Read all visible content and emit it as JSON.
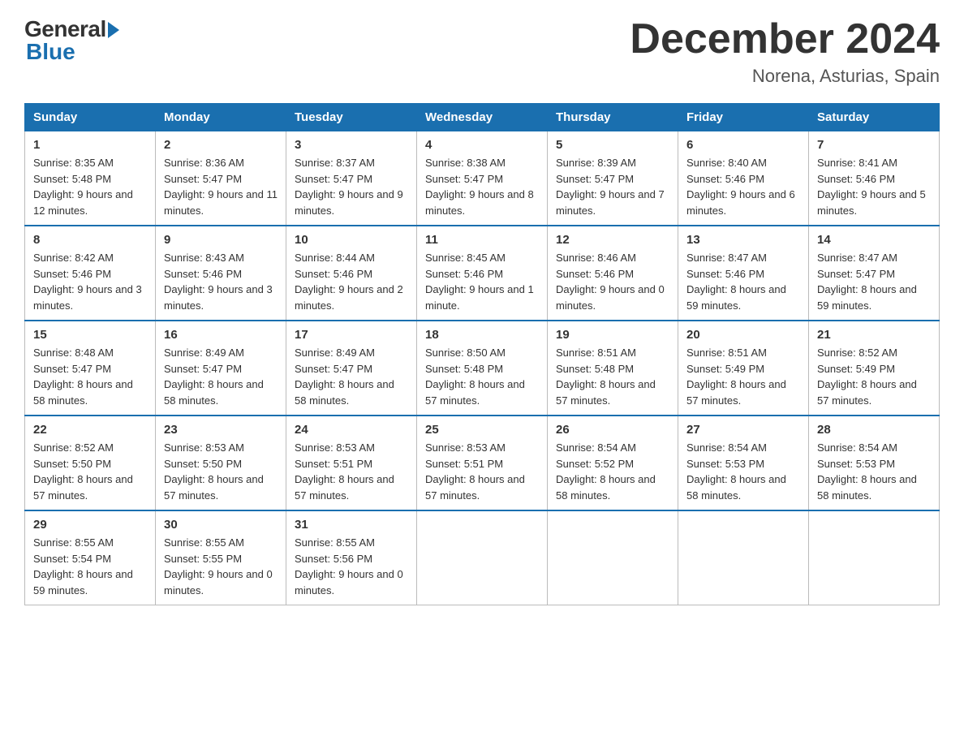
{
  "logo": {
    "general": "General",
    "blue": "Blue"
  },
  "title": "December 2024",
  "subtitle": "Norena, Asturias, Spain",
  "days_of_week": [
    "Sunday",
    "Monday",
    "Tuesday",
    "Wednesday",
    "Thursday",
    "Friday",
    "Saturday"
  ],
  "weeks": [
    [
      {
        "day": "1",
        "sunrise": "8:35 AM",
        "sunset": "5:48 PM",
        "daylight": "9 hours and 12 minutes."
      },
      {
        "day": "2",
        "sunrise": "8:36 AM",
        "sunset": "5:47 PM",
        "daylight": "9 hours and 11 minutes."
      },
      {
        "day": "3",
        "sunrise": "8:37 AM",
        "sunset": "5:47 PM",
        "daylight": "9 hours and 9 minutes."
      },
      {
        "day": "4",
        "sunrise": "8:38 AM",
        "sunset": "5:47 PM",
        "daylight": "9 hours and 8 minutes."
      },
      {
        "day": "5",
        "sunrise": "8:39 AM",
        "sunset": "5:47 PM",
        "daylight": "9 hours and 7 minutes."
      },
      {
        "day": "6",
        "sunrise": "8:40 AM",
        "sunset": "5:46 PM",
        "daylight": "9 hours and 6 minutes."
      },
      {
        "day": "7",
        "sunrise": "8:41 AM",
        "sunset": "5:46 PM",
        "daylight": "9 hours and 5 minutes."
      }
    ],
    [
      {
        "day": "8",
        "sunrise": "8:42 AM",
        "sunset": "5:46 PM",
        "daylight": "9 hours and 3 minutes."
      },
      {
        "day": "9",
        "sunrise": "8:43 AM",
        "sunset": "5:46 PM",
        "daylight": "9 hours and 3 minutes."
      },
      {
        "day": "10",
        "sunrise": "8:44 AM",
        "sunset": "5:46 PM",
        "daylight": "9 hours and 2 minutes."
      },
      {
        "day": "11",
        "sunrise": "8:45 AM",
        "sunset": "5:46 PM",
        "daylight": "9 hours and 1 minute."
      },
      {
        "day": "12",
        "sunrise": "8:46 AM",
        "sunset": "5:46 PM",
        "daylight": "9 hours and 0 minutes."
      },
      {
        "day": "13",
        "sunrise": "8:47 AM",
        "sunset": "5:46 PM",
        "daylight": "8 hours and 59 minutes."
      },
      {
        "day": "14",
        "sunrise": "8:47 AM",
        "sunset": "5:47 PM",
        "daylight": "8 hours and 59 minutes."
      }
    ],
    [
      {
        "day": "15",
        "sunrise": "8:48 AM",
        "sunset": "5:47 PM",
        "daylight": "8 hours and 58 minutes."
      },
      {
        "day": "16",
        "sunrise": "8:49 AM",
        "sunset": "5:47 PM",
        "daylight": "8 hours and 58 minutes."
      },
      {
        "day": "17",
        "sunrise": "8:49 AM",
        "sunset": "5:47 PM",
        "daylight": "8 hours and 58 minutes."
      },
      {
        "day": "18",
        "sunrise": "8:50 AM",
        "sunset": "5:48 PM",
        "daylight": "8 hours and 57 minutes."
      },
      {
        "day": "19",
        "sunrise": "8:51 AM",
        "sunset": "5:48 PM",
        "daylight": "8 hours and 57 minutes."
      },
      {
        "day": "20",
        "sunrise": "8:51 AM",
        "sunset": "5:49 PM",
        "daylight": "8 hours and 57 minutes."
      },
      {
        "day": "21",
        "sunrise": "8:52 AM",
        "sunset": "5:49 PM",
        "daylight": "8 hours and 57 minutes."
      }
    ],
    [
      {
        "day": "22",
        "sunrise": "8:52 AM",
        "sunset": "5:50 PM",
        "daylight": "8 hours and 57 minutes."
      },
      {
        "day": "23",
        "sunrise": "8:53 AM",
        "sunset": "5:50 PM",
        "daylight": "8 hours and 57 minutes."
      },
      {
        "day": "24",
        "sunrise": "8:53 AM",
        "sunset": "5:51 PM",
        "daylight": "8 hours and 57 minutes."
      },
      {
        "day": "25",
        "sunrise": "8:53 AM",
        "sunset": "5:51 PM",
        "daylight": "8 hours and 57 minutes."
      },
      {
        "day": "26",
        "sunrise": "8:54 AM",
        "sunset": "5:52 PM",
        "daylight": "8 hours and 58 minutes."
      },
      {
        "day": "27",
        "sunrise": "8:54 AM",
        "sunset": "5:53 PM",
        "daylight": "8 hours and 58 minutes."
      },
      {
        "day": "28",
        "sunrise": "8:54 AM",
        "sunset": "5:53 PM",
        "daylight": "8 hours and 58 minutes."
      }
    ],
    [
      {
        "day": "29",
        "sunrise": "8:55 AM",
        "sunset": "5:54 PM",
        "daylight": "8 hours and 59 minutes."
      },
      {
        "day": "30",
        "sunrise": "8:55 AM",
        "sunset": "5:55 PM",
        "daylight": "9 hours and 0 minutes."
      },
      {
        "day": "31",
        "sunrise": "8:55 AM",
        "sunset": "5:56 PM",
        "daylight": "9 hours and 0 minutes."
      },
      null,
      null,
      null,
      null
    ]
  ],
  "labels": {
    "sunrise": "Sunrise:",
    "sunset": "Sunset:",
    "daylight": "Daylight:"
  }
}
